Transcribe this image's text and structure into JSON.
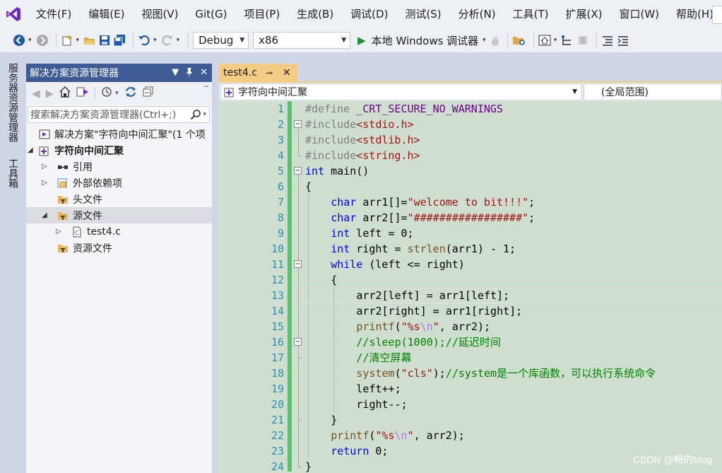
{
  "menu": {
    "items": [
      "文件(F)",
      "编辑(E)",
      "视图(V)",
      "Git(G)",
      "项目(P)",
      "生成(B)",
      "调试(D)",
      "测试(S)",
      "分析(N)",
      "工具(T)",
      "扩展(X)",
      "窗口(W)",
      "帮助(H)"
    ]
  },
  "toolbar": {
    "config": "Debug",
    "platform": "x86",
    "run_label": "本地 Windows 调试器"
  },
  "side_tabs": {
    "server_explorer": "服务器资源管理器",
    "toolbox": "工具箱"
  },
  "solution_explorer": {
    "title": "解决方案资源管理器",
    "search_placeholder": "搜索解决方案资源管理器(Ctrl+;)",
    "tree": [
      {
        "label": "解决方案\"字符向中间汇聚\"(1 个项",
        "level": 0,
        "expander": "",
        "icon": "solution-icon",
        "bold": false
      },
      {
        "label": "字符向中间汇聚",
        "level": 0,
        "expander": "◢",
        "icon": "project-icon",
        "bold": true
      },
      {
        "label": "引用",
        "level": 1,
        "expander": "▷",
        "icon": "references-icon",
        "bold": false
      },
      {
        "label": "外部依赖项",
        "level": 1,
        "expander": "▷",
        "icon": "external-deps-icon",
        "bold": false
      },
      {
        "label": "头文件",
        "level": 1,
        "expander": "",
        "icon": "filter-folder-icon",
        "bold": false
      },
      {
        "label": "源文件",
        "level": 1,
        "expander": "◢",
        "icon": "filter-folder-icon",
        "bold": false,
        "selected": true
      },
      {
        "label": "test4.c",
        "level": 2,
        "expander": "▷",
        "icon": "c-file-icon",
        "bold": false
      },
      {
        "label": "资源文件",
        "level": 1,
        "expander": "",
        "icon": "filter-folder-icon",
        "bold": false
      }
    ]
  },
  "editor": {
    "tab_title": "test4.c",
    "nav_scope": "字符向中间汇聚",
    "nav_member": "(全局范围)",
    "line_numbers": [
      "1",
      "2",
      "3",
      "4",
      "5",
      "6",
      "7",
      "8",
      "9",
      "10",
      "11",
      "12",
      "13",
      "14",
      "15",
      "16",
      "17",
      "18",
      "19",
      "20",
      "21",
      "22",
      "23",
      "24"
    ],
    "lines": [
      {
        "indent": 0,
        "tokens": [
          {
            "t": "#define ",
            "c": "pp"
          },
          {
            "t": "_CRT_SECURE_NO_WARNINGS",
            "c": "mac"
          }
        ]
      },
      {
        "indent": 0,
        "tokens": [
          {
            "t": "#include",
            "c": "pp"
          },
          {
            "t": "<stdio.h>",
            "c": "str"
          }
        ]
      },
      {
        "indent": 0,
        "tokens": [
          {
            "t": "#include",
            "c": "pp"
          },
          {
            "t": "<stdlib.h>",
            "c": "str"
          }
        ]
      },
      {
        "indent": 0,
        "tokens": [
          {
            "t": "#include",
            "c": "pp"
          },
          {
            "t": "<string.h>",
            "c": "str"
          }
        ]
      },
      {
        "indent": 0,
        "tokens": [
          {
            "t": "int",
            "c": "kw"
          },
          {
            "t": " main()",
            "c": ""
          }
        ]
      },
      {
        "indent": 0,
        "tokens": [
          {
            "t": "{",
            "c": ""
          }
        ]
      },
      {
        "indent": 1,
        "tokens": [
          {
            "t": "char",
            "c": "kw"
          },
          {
            "t": " arr1[]=",
            "c": ""
          },
          {
            "t": "\"welcome to bit!!!\"",
            "c": "str"
          },
          {
            "t": ";",
            "c": ""
          }
        ]
      },
      {
        "indent": 1,
        "tokens": [
          {
            "t": "char",
            "c": "kw"
          },
          {
            "t": " arr2[]=",
            "c": ""
          },
          {
            "t": "\"#################\"",
            "c": "str"
          },
          {
            "t": ";",
            "c": ""
          }
        ]
      },
      {
        "indent": 1,
        "tokens": [
          {
            "t": "int",
            "c": "kw"
          },
          {
            "t": " left = 0;",
            "c": ""
          }
        ]
      },
      {
        "indent": 1,
        "tokens": [
          {
            "t": "int",
            "c": "kw"
          },
          {
            "t": " right = ",
            "c": ""
          },
          {
            "t": "strlen",
            "c": "fn"
          },
          {
            "t": "(arr1) - 1;",
            "c": ""
          }
        ]
      },
      {
        "indent": 1,
        "tokens": [
          {
            "t": "while",
            "c": "kw"
          },
          {
            "t": " (left <= right)",
            "c": ""
          }
        ]
      },
      {
        "indent": 1,
        "tokens": [
          {
            "t": "{",
            "c": ""
          }
        ]
      },
      {
        "indent": 2,
        "tokens": [
          {
            "t": "arr2[left] = arr1[left];",
            "c": ""
          }
        ]
      },
      {
        "indent": 2,
        "tokens": [
          {
            "t": "arr2[right] = arr1[right];",
            "c": ""
          }
        ]
      },
      {
        "indent": 2,
        "tokens": [
          {
            "t": "printf",
            "c": "fn"
          },
          {
            "t": "(",
            "c": ""
          },
          {
            "t": "\"%s",
            "c": "str"
          },
          {
            "t": "\\n",
            "c": "esc"
          },
          {
            "t": "\"",
            "c": "str"
          },
          {
            "t": ", arr2);",
            "c": ""
          }
        ]
      },
      {
        "indent": 2,
        "tokens": [
          {
            "t": "//sleep(1000);//延迟时间",
            "c": "cm"
          }
        ]
      },
      {
        "indent": 2,
        "tokens": [
          {
            "t": "//清空屏幕",
            "c": "cm"
          }
        ]
      },
      {
        "indent": 2,
        "tokens": [
          {
            "t": "system",
            "c": "fn"
          },
          {
            "t": "(",
            "c": ""
          },
          {
            "t": "\"cls\"",
            "c": "str"
          },
          {
            "t": ");",
            "c": ""
          },
          {
            "t": "//system是一个库函数，可以执行系统命令",
            "c": "cm"
          }
        ]
      },
      {
        "indent": 2,
        "tokens": [
          {
            "t": "left++;",
            "c": ""
          }
        ]
      },
      {
        "indent": 2,
        "tokens": [
          {
            "t": "right--;",
            "c": ""
          }
        ]
      },
      {
        "indent": 1,
        "tokens": [
          {
            "t": "}",
            "c": ""
          }
        ]
      },
      {
        "indent": 1,
        "tokens": [
          {
            "t": "printf",
            "c": "fn"
          },
          {
            "t": "(",
            "c": ""
          },
          {
            "t": "\"%s",
            "c": "str"
          },
          {
            "t": "\\n",
            "c": "esc"
          },
          {
            "t": "\"",
            "c": "str"
          },
          {
            "t": ", arr2);",
            "c": ""
          }
        ]
      },
      {
        "indent": 1,
        "tokens": [
          {
            "t": "return",
            "c": "kw"
          },
          {
            "t": " 0;",
            "c": ""
          }
        ]
      },
      {
        "indent": 0,
        "tokens": [
          {
            "t": "}",
            "c": ""
          }
        ]
      }
    ]
  },
  "watermark": "CSDN @畅的blog",
  "colors": {
    "accent": "#3f5b96",
    "tab_active": "#f5cc84",
    "editor_bg": "#cfdfcf",
    "keyword": "#0000ff",
    "string": "#a31515",
    "comment": "#008000",
    "line_number": "#2b91af",
    "change_bar": "#57c26b"
  }
}
